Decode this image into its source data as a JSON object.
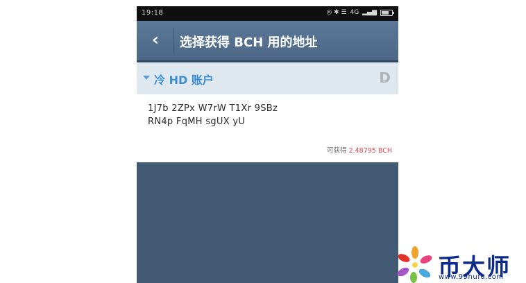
{
  "status_bar": {
    "time": "19:18",
    "network": "4G",
    "signal_icons": "◎ ✱ ☰"
  },
  "toolbar": {
    "back_icon": "‹",
    "title": "选择获得 BCH 用的地址"
  },
  "account": {
    "name": "冷 HD 账户",
    "letter": "D"
  },
  "address": {
    "line1": "1J7b 2ZPx W7rW T1Xr 9SBz",
    "line2": "RN4p FqMH sgUX yU",
    "available_label": "可获得 ",
    "available_amount": "2.48795 BCH"
  },
  "watermark": {
    "text": "币大师",
    "url": "www.99hufu.com"
  },
  "colors": {
    "toolbar": "#4d6886",
    "background": "#435a75",
    "account_text": "#3c8fd3",
    "amount": "#e0474c"
  }
}
